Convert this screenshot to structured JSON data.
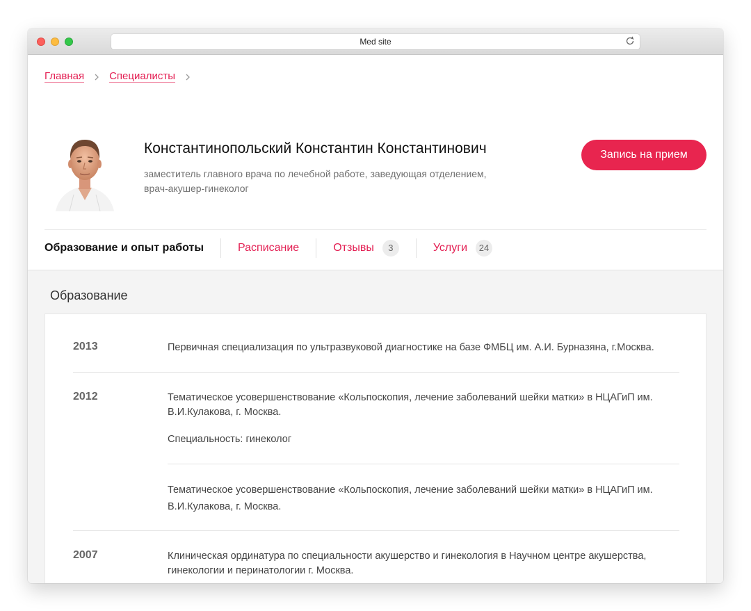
{
  "browser": {
    "url_title": "Med site"
  },
  "breadcrumb": {
    "items": [
      "Главная",
      "Специалисты"
    ]
  },
  "doctor": {
    "name": "Константинопольский Константин Константинович",
    "position": "заместитель главного врача по лечебной работе, заведующая отделением, врач-акушер-гинеколог",
    "appointment_label": "Запись на прием"
  },
  "tabs": [
    {
      "label": "Образование и опыт работы",
      "active": true
    },
    {
      "label": "Расписание"
    },
    {
      "label": "Отзывы",
      "count": "3"
    },
    {
      "label": "Услуги",
      "count": "24"
    }
  ],
  "education": {
    "title": "Образование",
    "entries": [
      {
        "year": "2013",
        "text": "Первичная специализация по ультразвуковой диагностике на базе ФМБЦ им. А.И. Бурназяна, г.Москва."
      },
      {
        "year": "2012",
        "text": "Тематическое усовершенствование «Кольпоскопия, лечение заболеваний шейки матки» в НЦАГиП им. В.И.Кулакова, г. Москва.",
        "specialty": "Специальность: гинеколог",
        "extra": "Тематическое усовершенствование «Кольпоскопия, лечение заболеваний шейки матки» в НЦАГиП им. В.И.Кулакова, г. Москва."
      },
      {
        "year": "2007",
        "text": "Клиническая ординатура по специальности акушерство и гинекология в Научном центре акушерства, гинекологии и перинатологии г. Москва."
      }
    ]
  },
  "colors": {
    "accent": "#e8254f",
    "link": "#e31e52",
    "page_bg": "#f4f4f4"
  },
  "icons": [
    "reload-icon",
    "chevron-right-icon",
    "doctor-photo"
  ]
}
